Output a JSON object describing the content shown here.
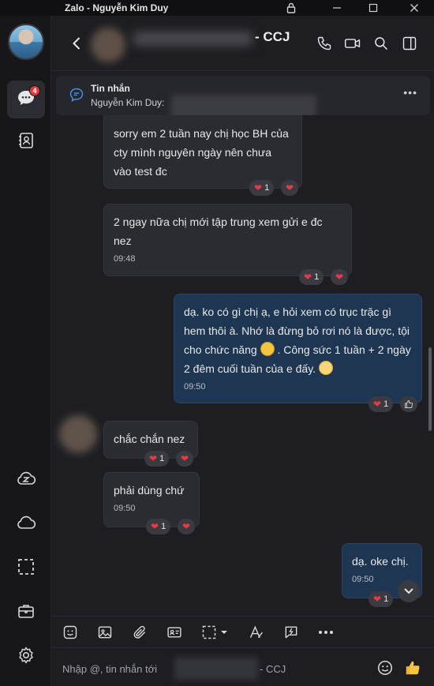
{
  "window": {
    "title": "Zalo - Nguyễn Kim Duy"
  },
  "nav": {
    "messages_badge": "4"
  },
  "header": {
    "title": "- CCJ"
  },
  "pinned": {
    "label": "Tin nhắn",
    "sender": "Nguyễn Kim Duy:"
  },
  "messages": [
    {
      "dir": "in",
      "text": "sorry em 2 tuần nay chị học BH của cty mình nguyên ngày nên chưa vào test đc",
      "time": "",
      "react_count": "1"
    },
    {
      "dir": "in",
      "text": "2 ngay nữa chị mới tập trung xem gửi e đc nez",
      "time": "09:48",
      "react_count": "1"
    },
    {
      "dir": "out",
      "text_a": "dạ. ko có gì chị ạ, e hỏi xem có trục trặc gì hem thôi à. Nhớ là đừng bỏ rơi nó là được, tội cho chức năng",
      "text_b": ". Công sức 1 tuần + 2 ngày 2 đêm cuối tuần của e đấy.",
      "time": "09:50",
      "react_count": "1"
    },
    {
      "dir": "in",
      "text": "chắc chắn nez",
      "time": "",
      "react_count": "1"
    },
    {
      "dir": "in",
      "text": "phải dùng chứ",
      "time": "09:50",
      "react_count": "1"
    },
    {
      "dir": "out",
      "text": "dạ. oke chị.",
      "time": "09:50",
      "react_count": "1"
    }
  ],
  "composer": {
    "placeholder_prefix": "Nhập @, tin nhắn tới",
    "placeholder_suffix": "- CCJ"
  },
  "colors": {
    "accent": "#4a90e2",
    "badge": "#e53935",
    "heart": "#e53945",
    "out_bubble": "#1f3653",
    "in_bubble": "#2b2c31"
  }
}
